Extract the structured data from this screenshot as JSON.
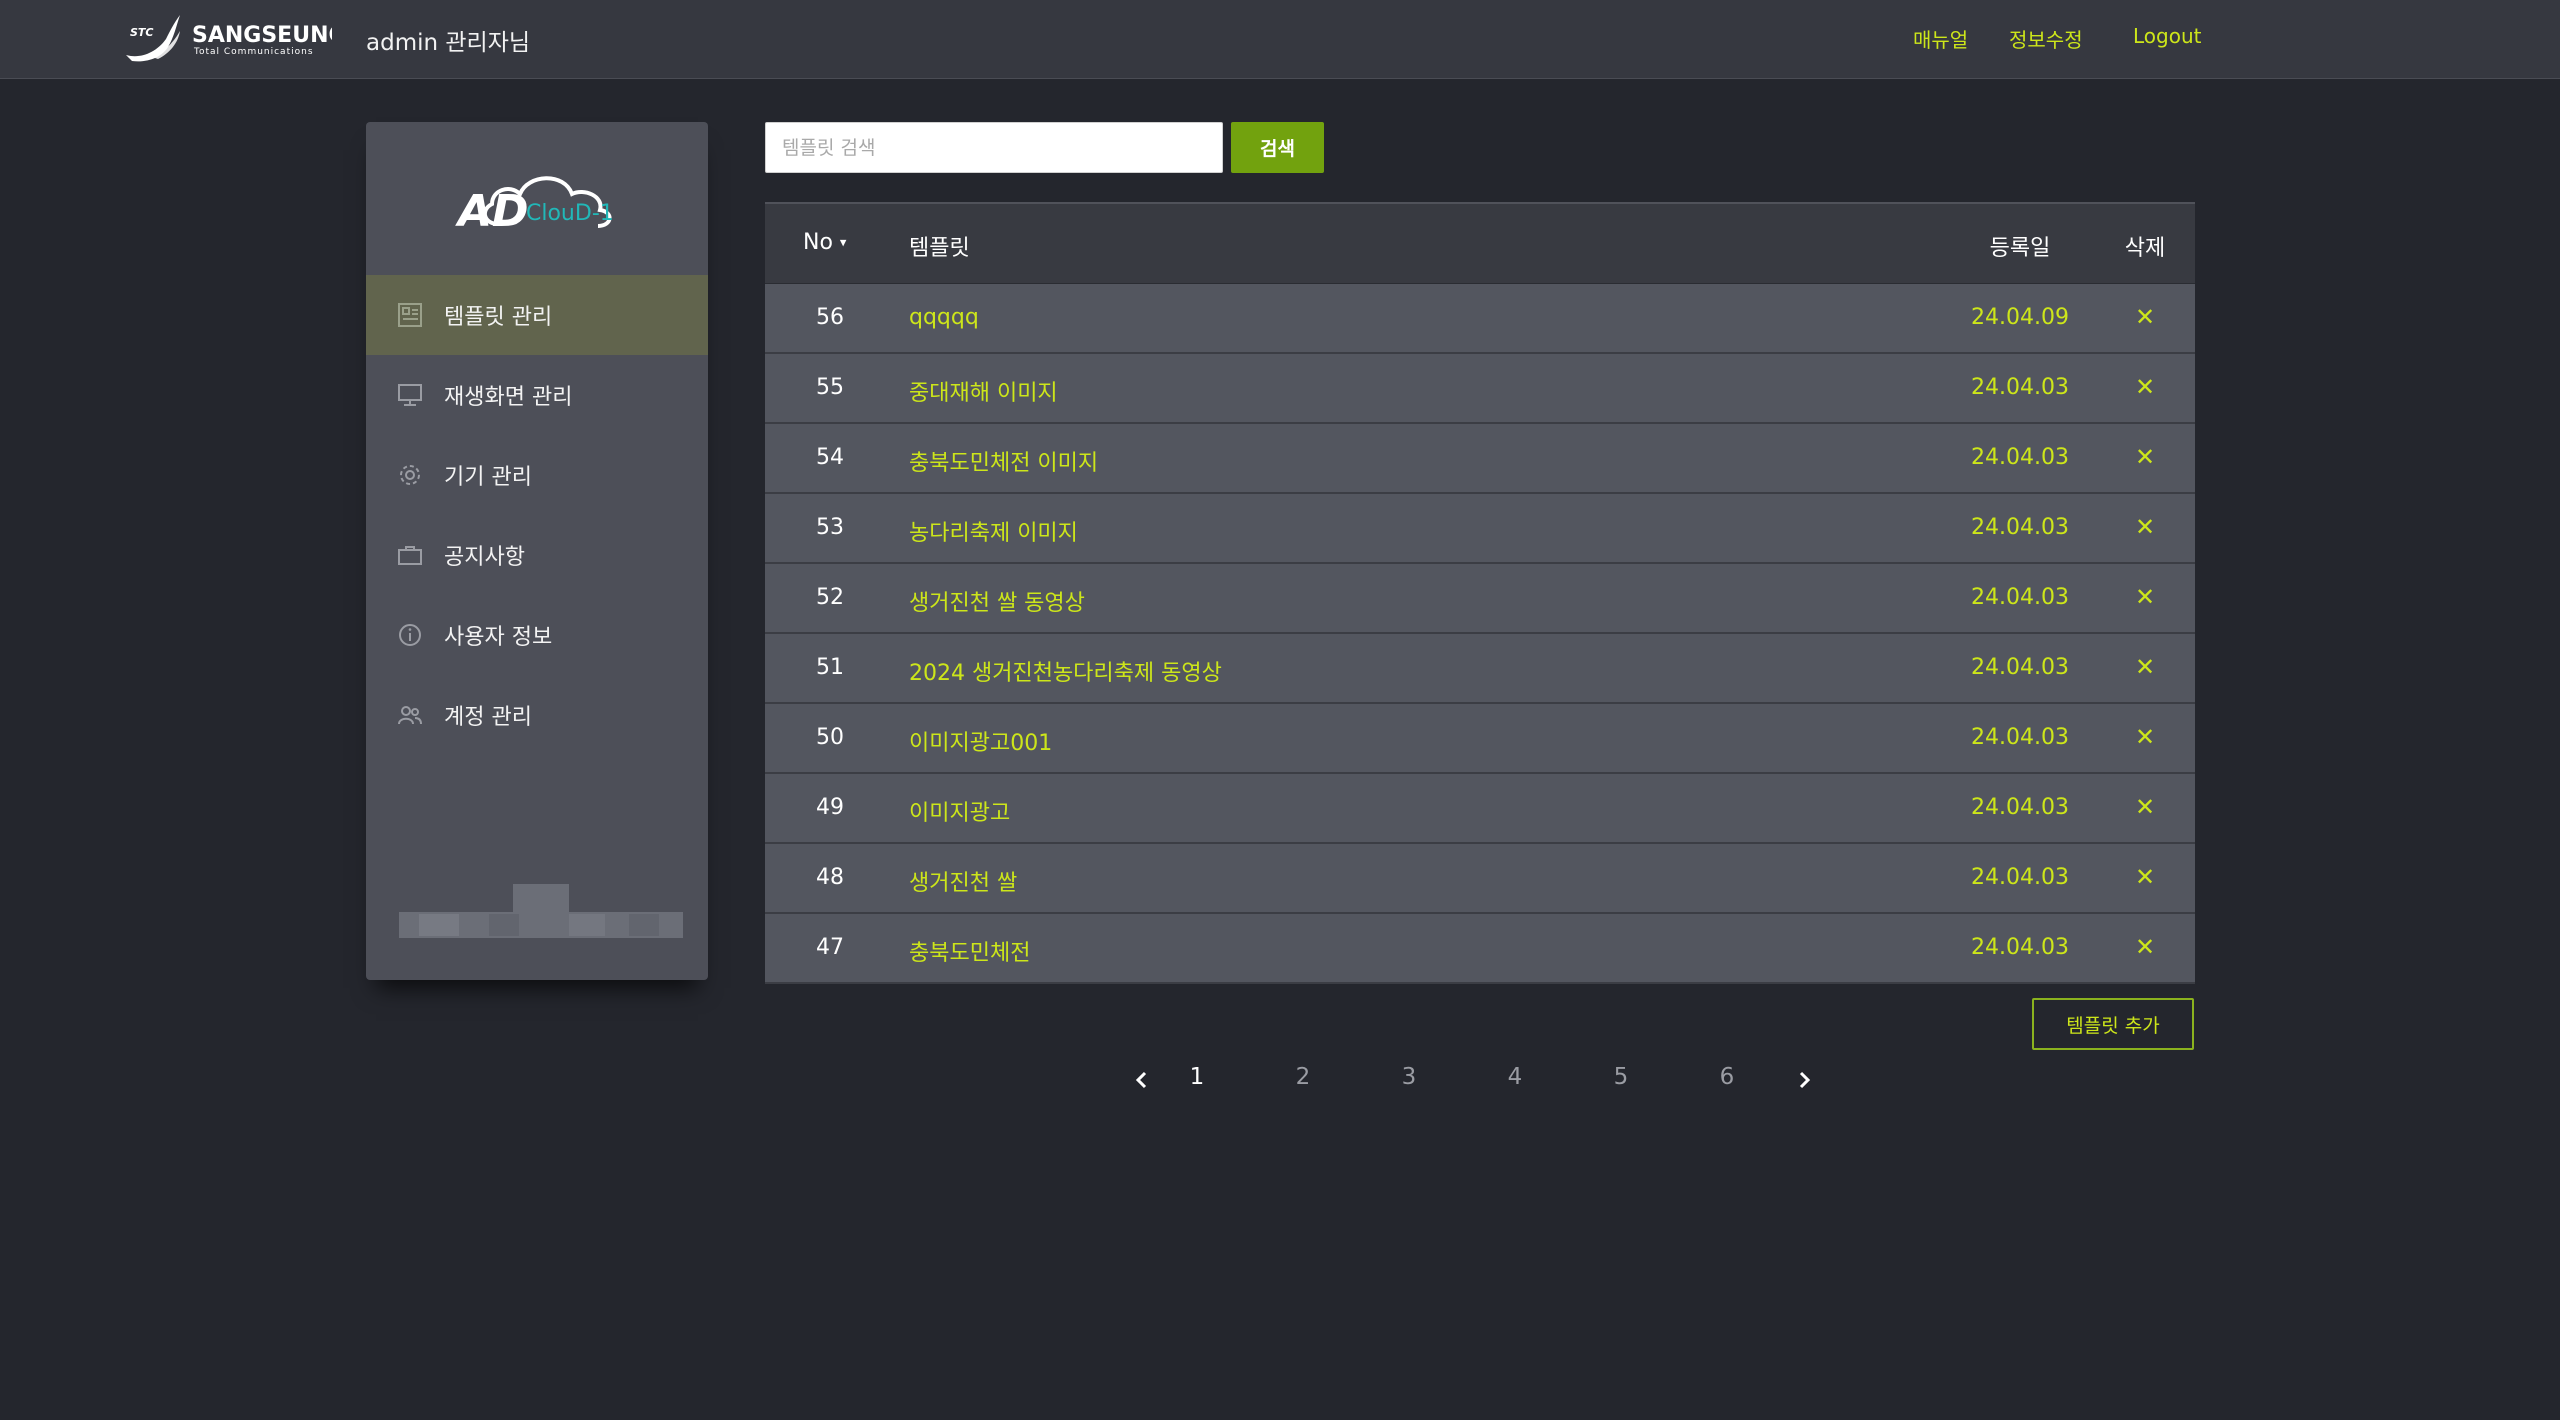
{
  "header": {
    "brand_name": "SANGSEUNG",
    "brand_sub": "Total Communications",
    "brand_badge": "STC",
    "admin_label": "admin 관리자님",
    "links": [
      "매뉴얼",
      "정보수정",
      "Logout"
    ]
  },
  "sidebar": {
    "logo_text_main": "AD",
    "logo_text_sub": "ClouD-1",
    "items": [
      {
        "label": "템플릿 관리",
        "icon": "template-icon",
        "active": true
      },
      {
        "label": "재생화면 관리",
        "icon": "monitor-icon",
        "active": false
      },
      {
        "label": "기기 관리",
        "icon": "gear-icon",
        "active": false
      },
      {
        "label": "공지사항",
        "icon": "briefcase-icon",
        "active": false
      },
      {
        "label": "사용자 정보",
        "icon": "info-icon",
        "active": false
      },
      {
        "label": "계정 관리",
        "icon": "users-icon",
        "active": false
      }
    ]
  },
  "search": {
    "placeholder": "템플릿 검색",
    "value": "",
    "button_label": "검색"
  },
  "table": {
    "headers": {
      "no": "No",
      "template": "템플릿",
      "date": "등록일",
      "delete": "삭제"
    },
    "sort_indicator": "▾",
    "delete_symbol": "✕",
    "rows": [
      {
        "no": "56",
        "name": "qqqqq",
        "date": "24.04.09"
      },
      {
        "no": "55",
        "name": "중대재해 이미지",
        "date": "24.04.03"
      },
      {
        "no": "54",
        "name": "충북도민체전 이미지",
        "date": "24.04.03"
      },
      {
        "no": "53",
        "name": "농다리축제 이미지",
        "date": "24.04.03"
      },
      {
        "no": "52",
        "name": "생거진천 쌀 동영상",
        "date": "24.04.03"
      },
      {
        "no": "51",
        "name": "2024 생거진천농다리축제 동영상",
        "date": "24.04.03"
      },
      {
        "no": "50",
        "name": "이미지광고001",
        "date": "24.04.03"
      },
      {
        "no": "49",
        "name": "이미지광고",
        "date": "24.04.03"
      },
      {
        "no": "48",
        "name": "생거진천 쌀",
        "date": "24.04.03"
      },
      {
        "no": "47",
        "name": "충북도민체전",
        "date": "24.04.03"
      }
    ]
  },
  "add_button_label": "템플릿 추가",
  "pagination": {
    "pages": [
      "1",
      "2",
      "3",
      "4",
      "5",
      "6"
    ],
    "current": "1"
  },
  "colors": {
    "accent": "#cde61a",
    "button_green": "#72a20e",
    "background": "#24262d",
    "topbar": "#363840",
    "sidebar": "#4d4f58",
    "sidebar_active": "#61644d",
    "row": "#53565f"
  }
}
